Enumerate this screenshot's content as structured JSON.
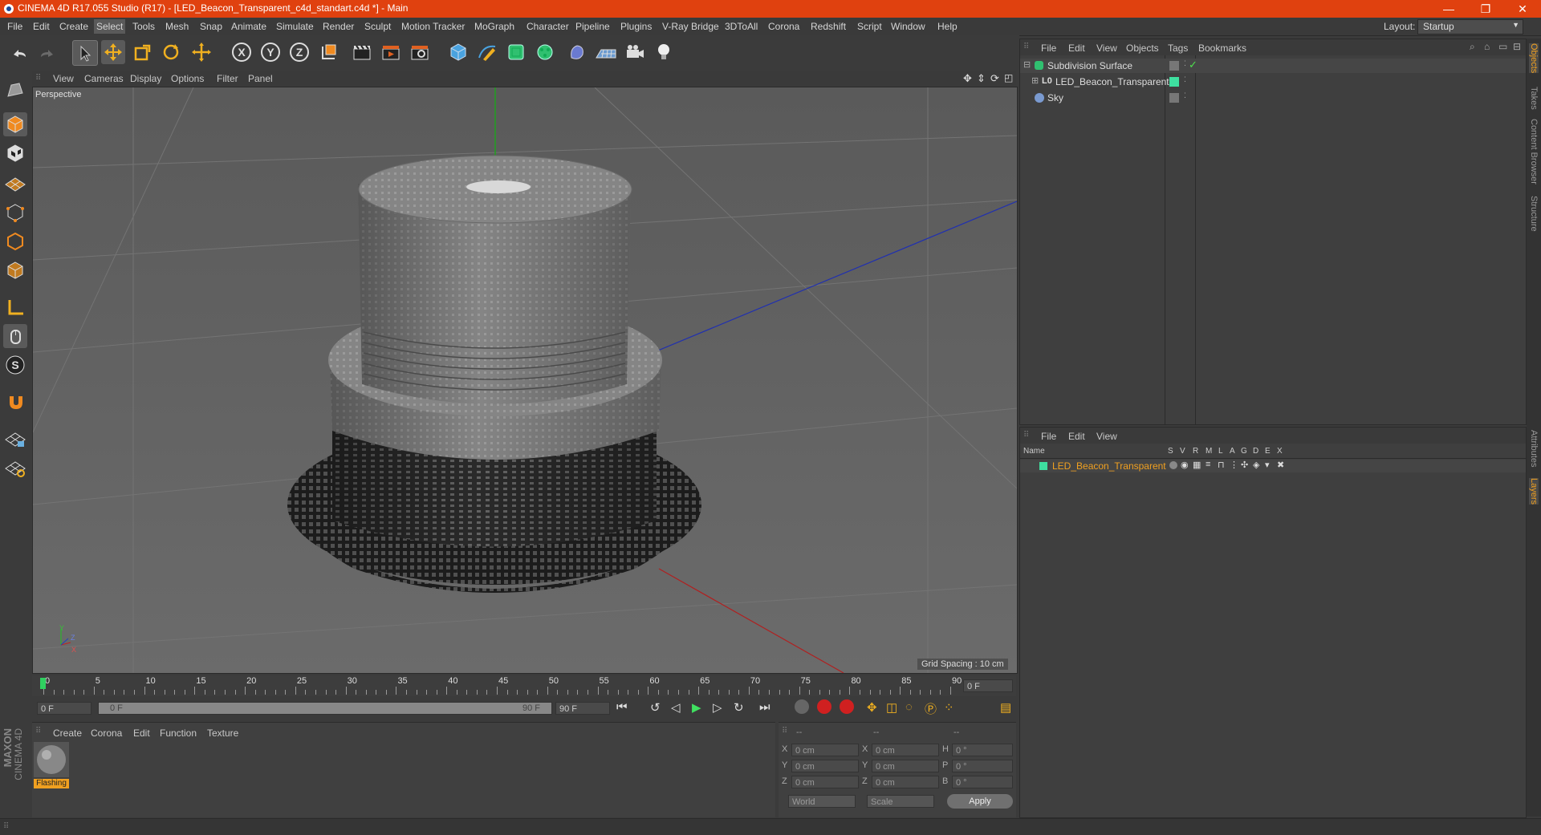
{
  "app": {
    "title": "CINEMA 4D R17.055 Studio (R17) - [LED_Beacon_Transparent_c4d_standart.c4d *] - Main",
    "layout_label": "Layout:",
    "layout_value": "Startup",
    "brand_line1": "MAXON",
    "brand_line2": "CINEMA 4D",
    "accent_color": "#e0410f"
  },
  "window_controls": {
    "minimize": "—",
    "restore": "❐",
    "close": "✕"
  },
  "menu": [
    "File",
    "Edit",
    "Create",
    "Select",
    "Tools",
    "Mesh",
    "Snap",
    "Animate",
    "Simulate",
    "Render",
    "Sculpt",
    "Motion Tracker",
    "MoGraph",
    "Character",
    "Pipeline",
    "Plugins",
    "V-Ray Bridge",
    "3DToAll",
    "Corona",
    "Redshift",
    "Script",
    "Window",
    "Help"
  ],
  "viewport": {
    "menu": [
      "View",
      "Cameras",
      "Display",
      "Options",
      "Filter",
      "Panel"
    ],
    "label": "Perspective",
    "grid_spacing": "Grid Spacing : 10 cm",
    "axis_y": "Y",
    "axis_z": "Z",
    "axis_x": "X"
  },
  "timeline": {
    "ticks": [
      "0",
      "5",
      "10",
      "15",
      "20",
      "25",
      "30",
      "35",
      "40",
      "45",
      "50",
      "55",
      "60",
      "65",
      "70",
      "75",
      "80",
      "85",
      "90"
    ],
    "current_frame": "0 F",
    "start_field": "0 F",
    "range_start": "0 F",
    "range_end": "90 F",
    "end_field": "90 F"
  },
  "material_panel": {
    "menu": [
      "Create",
      "Corona",
      "Edit",
      "Function",
      "Texture"
    ],
    "material_name": "Flashing"
  },
  "coord_panel": {
    "headers": [
      "--",
      "--",
      "--"
    ],
    "rows": [
      {
        "a": "X",
        "av": "0 cm",
        "b": "X",
        "bv": "0 cm",
        "c": "H",
        "cv": "0 °"
      },
      {
        "a": "Y",
        "av": "0 cm",
        "b": "Y",
        "bv": "0 cm",
        "c": "P",
        "cv": "0 °"
      },
      {
        "a": "Z",
        "av": "0 cm",
        "b": "Z",
        "bv": "0 cm",
        "c": "B",
        "cv": "0 °"
      }
    ],
    "world": "World",
    "scale": "Scale",
    "apply": "Apply"
  },
  "object_manager": {
    "menu": [
      "File",
      "Edit",
      "View",
      "Objects",
      "Tags",
      "Bookmarks"
    ],
    "items": [
      {
        "name": "Subdivision Surface"
      },
      {
        "name": "LED_Beacon_Transparent"
      },
      {
        "name": "Sky"
      }
    ]
  },
  "layer_manager": {
    "menu": [
      "File",
      "Edit",
      "View"
    ],
    "columns": [
      "Name",
      "S",
      "V",
      "R",
      "M",
      "L",
      "A",
      "G",
      "D",
      "E",
      "X"
    ],
    "layer_name": "LED_Beacon_Transparent",
    "layer_color": "#3ee0a0"
  },
  "right_tabs": [
    "Objects",
    "Takes",
    "Content Browser",
    "Structure",
    "Attributes",
    "Layers"
  ]
}
